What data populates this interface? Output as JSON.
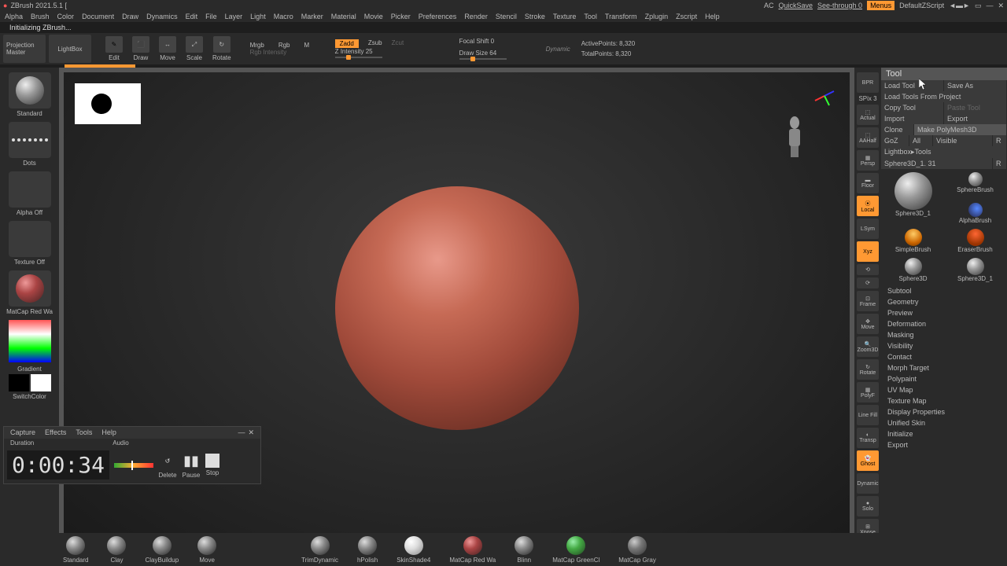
{
  "title": "ZBrush 2021.5.1 [",
  "titlebar_right": {
    "ac": "AC",
    "quicksave": "QuickSave",
    "seethrough": "See-through  0",
    "menus": "Menus",
    "script": "DefaultZScript"
  },
  "menubar": [
    "Alpha",
    "Brush",
    "Color",
    "Document",
    "Draw",
    "Dynamics",
    "Edit",
    "File",
    "Layer",
    "Light",
    "Macro",
    "Marker",
    "Material",
    "Movie",
    "Picker",
    "Preferences",
    "Render",
    "Stencil",
    "Stroke",
    "Texture",
    "Tool",
    "Transform",
    "Zplugin",
    "Zscript",
    "Help"
  ],
  "status": "Initializing ZBrush...",
  "topbar": {
    "projection": "Projection Master",
    "lightbox": "LightBox",
    "edit": "Edit",
    "draw": "Draw",
    "move": "Move",
    "scale": "Scale",
    "rotate": "Rotate",
    "mrgb": "Mrgb",
    "rgb": "Rgb",
    "m": "M",
    "rgb_int": "Rgb Intensity",
    "zadd": "Zadd",
    "zsub": "Zsub",
    "zcut": "Zcut",
    "z_int": "Z Intensity 25",
    "focal": "Focal Shift 0",
    "draw_size": "Draw Size 64",
    "dynamic": "Dynamic",
    "active": "ActivePoints: 8,320",
    "total": "TotalPoints: 8,320"
  },
  "left": {
    "standard": "Standard",
    "dots": "Dots",
    "alpha": "Alpha Off",
    "texture": "Texture Off",
    "material": "MatCap Red Wa",
    "gradient": "Gradient",
    "switch": "SwitchColor"
  },
  "rail": {
    "bpr": "BPR",
    "spix": "SPix 3",
    "actual": "Actual",
    "aahalf": "AAHalf",
    "persp": "Persp",
    "floor": "Floor",
    "local": "Local",
    "lsym": "LSym",
    "xyz": "Xyz",
    "frame": "Frame",
    "move": "Move",
    "zoom": "Zoom3D",
    "rotate": "Rotate",
    "polyf": "PolyF",
    "linefill": "Line Fill",
    "transp": "Transp",
    "ghost": "Ghost",
    "solo": "Solo",
    "xpose": "Xpose",
    "dynamic": "Dynamic"
  },
  "tool": {
    "header": "Tool",
    "load": "Load Tool",
    "saveas": "Save As",
    "loadproj": "Load Tools From Project",
    "copy": "Copy Tool",
    "paste": "Paste Tool",
    "import": "Import",
    "export": "Export",
    "clone": "Clone",
    "makepoly": "Make PolyMesh3D",
    "goz": "GoZ",
    "all": "All",
    "visible": "Visible",
    "r": "R",
    "lightbox": "Lightbox▸Tools",
    "current": "Sphere3D_1. 31",
    "items": [
      "Sphere3D_1",
      "SphereBrush",
      "AlphaBrush",
      "SimpleBrush",
      "EraserBrush",
      "Sphere3D",
      "Sphere3D_1"
    ],
    "sections": [
      "Subtool",
      "Geometry",
      "Preview",
      "Deformation",
      "Masking",
      "Visibility",
      "Contact",
      "Morph Target",
      "Polypaint",
      "UV Map",
      "Texture Map",
      "Display Properties",
      "Unified Skin",
      "Initialize",
      "Export"
    ]
  },
  "recorder": {
    "menu": [
      "Capture",
      "Effects",
      "Tools",
      "Help"
    ],
    "duration_label": "Duration",
    "audio_label": "Audio",
    "time": "0:00:34",
    "delete": "Delete",
    "pause": "Pause",
    "stop": "Stop"
  },
  "brushes": [
    "Standard",
    "Clay",
    "ClayBuildup",
    "Move",
    "TrimDynamic",
    "hPolish",
    "SkinShade4",
    "MatCap Red Wa",
    "Blinn",
    "MatCap GreenCl",
    "MatCap Gray"
  ]
}
